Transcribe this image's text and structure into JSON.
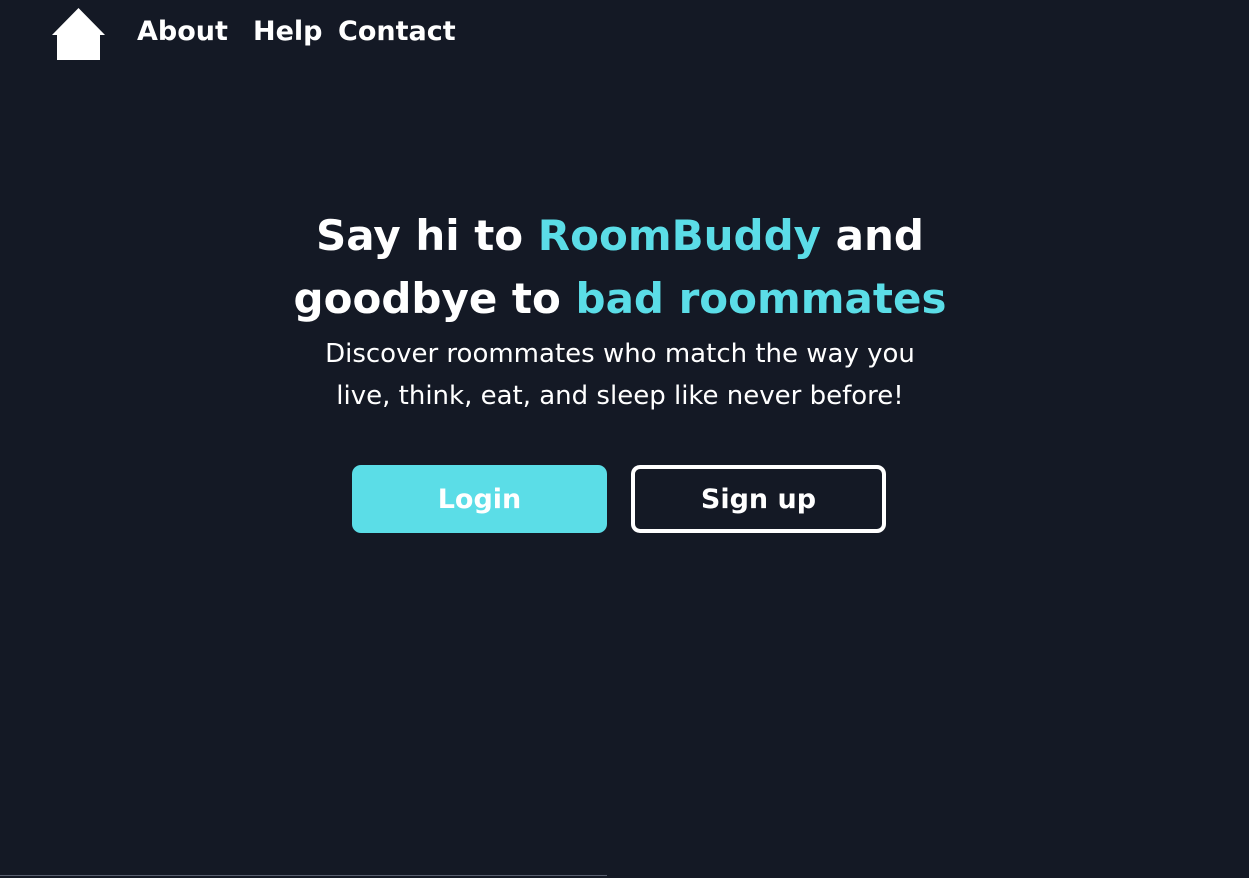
{
  "nav": {
    "home_icon": "house-icon",
    "links": [
      "About",
      "Help",
      "Contact"
    ]
  },
  "hero": {
    "headline_line1_part1": "Say hi to ",
    "headline_brand": "RoomBuddy",
    "headline_line1_part2": " and",
    "headline_line2_part1": "goodbye to ",
    "headline_accent": "bad roommates",
    "tagline": "Discover roommates who match the way you live, think, eat, and sleep like never before!"
  },
  "buttons": {
    "login": "Login",
    "signup": "Sign up"
  },
  "colors": {
    "background": "#141925",
    "accent": "#5bdde7",
    "text": "#ffffff"
  }
}
